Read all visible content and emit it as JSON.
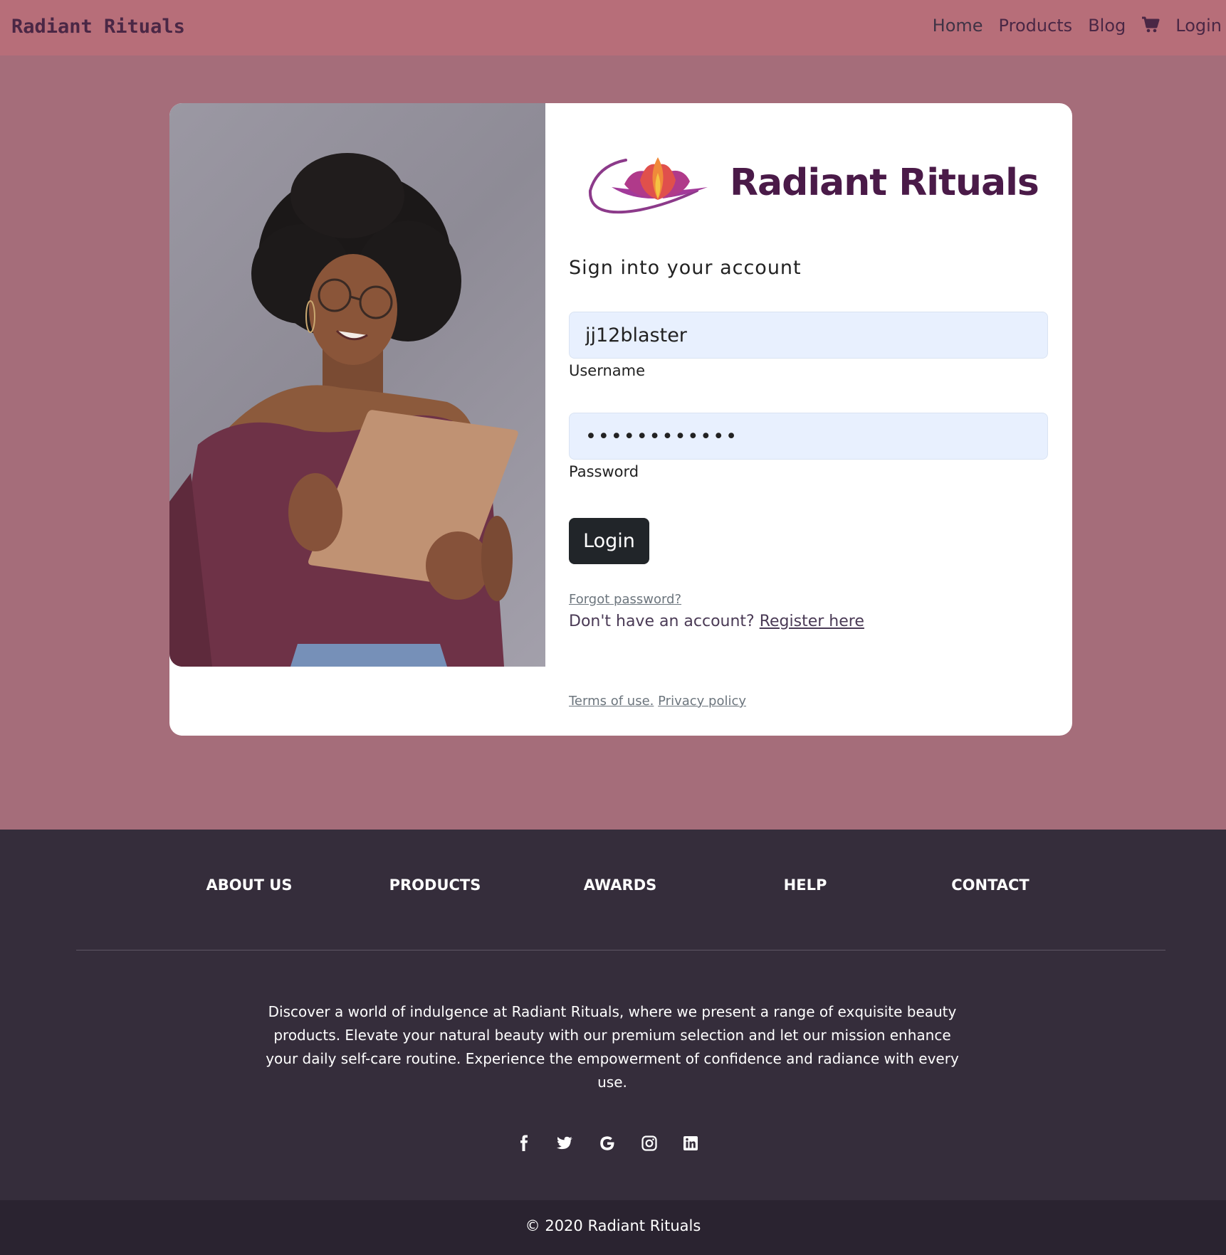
{
  "navbar": {
    "brand": "Radiant Rituals",
    "links": {
      "home": "Home",
      "products": "Products",
      "blog": "Blog",
      "login": "Login"
    },
    "cart_icon": "shopping-cart-icon"
  },
  "login_card": {
    "logo_title": "Radiant Rituals",
    "subtitle": "Sign into your account",
    "username_value": "jj12blaster",
    "username_label": "Username",
    "password_value": "••••••••••••",
    "password_label": "Password",
    "login_button": "Login",
    "forgot_password": "Forgot password?",
    "no_account_text": "Don't have an account? ",
    "register_link": "Register here",
    "terms": "Terms of use.",
    "privacy": "Privacy policy"
  },
  "footer": {
    "links": [
      "ABOUT US",
      "PRODUCTS",
      "AWARDS",
      "HELP",
      "CONTACT"
    ],
    "description": "Discover a world of indulgence at Radiant Rituals, where we present a range of exquisite beauty products. Elevate your natural beauty with our premium selection and let our mission enhance your daily self-care routine. Experience the empowerment of confidence and radiance with every use.",
    "social_icons": [
      "facebook-icon",
      "twitter-icon",
      "google-icon",
      "instagram-icon",
      "linkedin-icon"
    ],
    "copyright": "© 2020 Radiant Rituals"
  },
  "colors": {
    "navbar": "#b76e79",
    "page_bg": "#a56d7a",
    "footer_bg": "#352d3b",
    "bottom_bar": "#2a2330",
    "brand_text": "#4a1a48",
    "input_bg": "#e8f0fe",
    "button_bg": "#212529"
  }
}
